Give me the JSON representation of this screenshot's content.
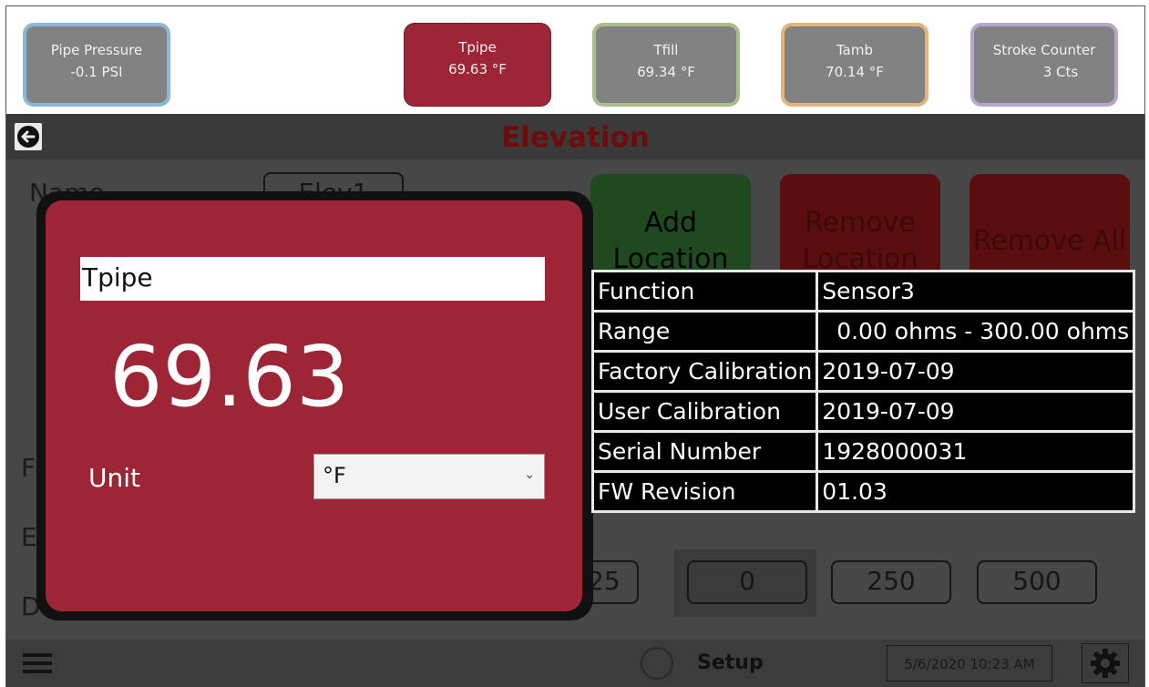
{
  "sensors": [
    {
      "name": "Pipe Pressure",
      "value": "-0.1 PSI",
      "border": "#89b8d6"
    },
    {
      "name": "Tpipe",
      "value": "69.63 °F",
      "border": "#9e2535"
    },
    {
      "name": "Tfill",
      "value": "69.34 °F",
      "border": "#a9be8c"
    },
    {
      "name": "Tamb",
      "value": "70.14 °F",
      "border": "#e2b67a"
    },
    {
      "name": "Stroke Counter",
      "value": "3 Cts",
      "border": "#b5a7c8"
    }
  ],
  "page": {
    "title": "Elevation",
    "name_label": "Name",
    "name_value": "Elev1",
    "row_labels": [
      "F",
      "E",
      "D"
    ],
    "buttons": {
      "add_location": "Add Location",
      "remove_location": "Remove Location",
      "remove_all": "Remove All"
    },
    "distance_cells": [
      "125",
      "0",
      "250",
      "500"
    ]
  },
  "popup": {
    "sensor_name": "Tpipe",
    "value": "69.63",
    "unit_label": "Unit",
    "unit_selected": "°F"
  },
  "info_table": [
    {
      "key": "Function",
      "value": "Sensor3"
    },
    {
      "key": "Range",
      "value": "  0.00 ohms - 300.00 ohms"
    },
    {
      "key": "Factory Calibration",
      "value": "2019-07-09"
    },
    {
      "key": "User Calibration",
      "value": "2019-07-09"
    },
    {
      "key": "Serial Number",
      "value": "1928000031"
    },
    {
      "key": "FW Revision",
      "value": "01.03"
    }
  ],
  "bottom": {
    "setup_label": "Setup",
    "datetime": "5/6/2020 10:23 AM"
  },
  "icons": {
    "back": "back-arrow-icon",
    "menu": "hamburger-menu-icon",
    "status": "status-circle-icon",
    "settings": "gear-icon"
  },
  "colors": {
    "accent_red": "#9e2535",
    "tile_gray": "#828282",
    "title_red": "#6e0b0b"
  }
}
